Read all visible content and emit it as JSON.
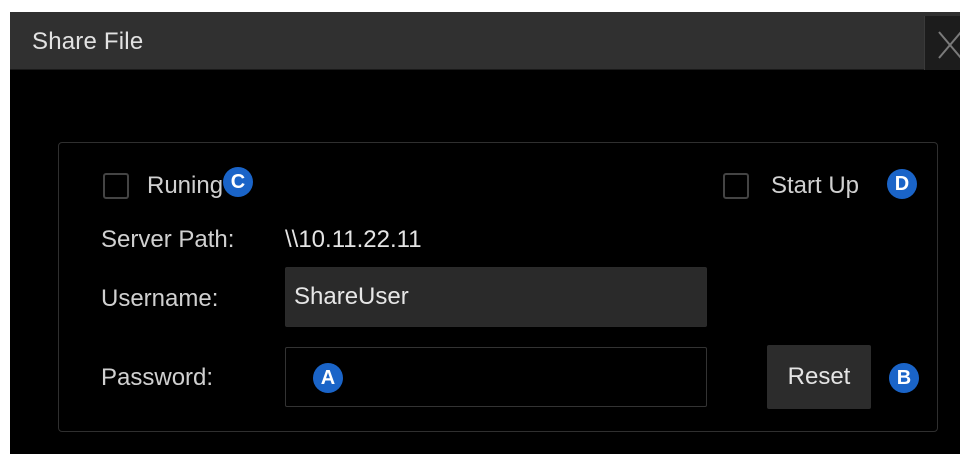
{
  "dialog": {
    "title": "Share File"
  },
  "running": {
    "label": "Runing",
    "checked": false
  },
  "startup": {
    "label": "Start Up",
    "checked": false
  },
  "server_path": {
    "label": "Server Path:",
    "value": "\\\\10.11.22.11"
  },
  "username": {
    "label": "Username:",
    "value": "ShareUser"
  },
  "password": {
    "label": "Password:",
    "value": ""
  },
  "buttons": {
    "reset": "Reset"
  },
  "callouts": {
    "a": "A",
    "b": "B",
    "c": "C",
    "d": "D"
  },
  "colors": {
    "background": "#000000",
    "titlebar": "#303030",
    "callout": "#1a64c8",
    "text": "#d8d8d8"
  }
}
